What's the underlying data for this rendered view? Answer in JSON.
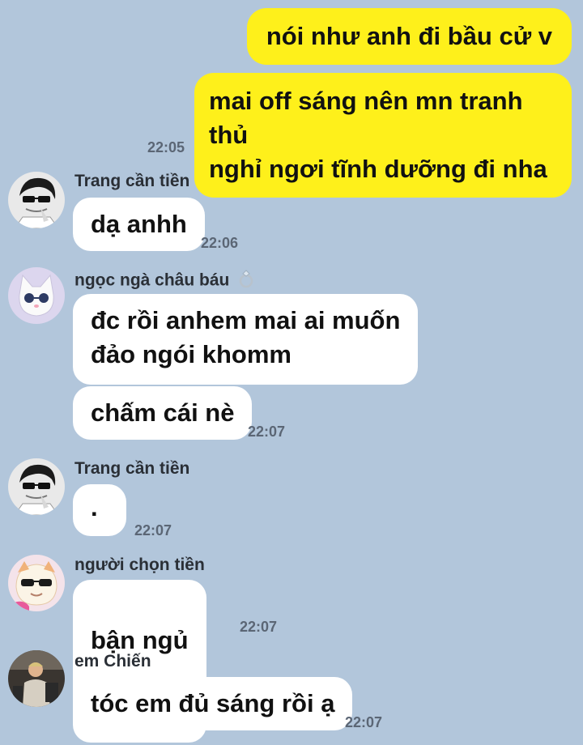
{
  "messages": {
    "m1": {
      "text": "nói như anh đi bầu cử v"
    },
    "m2": {
      "text": "mai off sáng nên mn tranh thủ\nnghỉ ngơi tĩnh dưỡng đi nha",
      "time": "22:05"
    },
    "m3": {
      "sender": "Trang cần tiền",
      "text": "dạ anhh",
      "time": "22:06"
    },
    "m4": {
      "sender": "ngọc ngà châu báu",
      "sender_badge": "ring-icon",
      "text": "đc rồi anhem mai ai muốn\nđảo ngói khomm"
    },
    "m5": {
      "text": "chấm cái nè",
      "time": "22:07"
    },
    "m6": {
      "sender": "Trang cần tiền",
      "text": ".",
      "time": "22:07"
    },
    "m7": {
      "sender": "người chọn tiền",
      "text": "bận ngủ",
      "emoji": "sleeping-face-icon",
      "time": "22:07"
    },
    "m8": {
      "sender": "em Chiến",
      "text": "tóc em đủ sáng rồi ạ",
      "time": "22:07"
    }
  },
  "colors": {
    "background": "#b2c6db",
    "my_bubble": "#fef01b",
    "their_bubble": "#ffffff",
    "timestamp": "#5b6675"
  }
}
